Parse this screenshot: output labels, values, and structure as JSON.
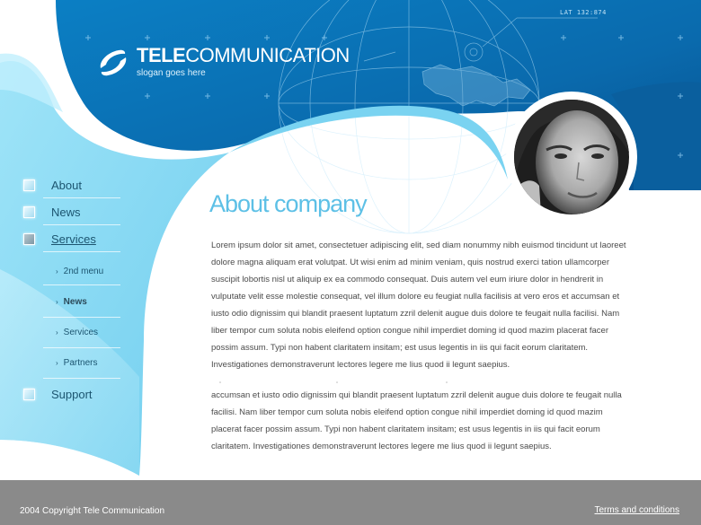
{
  "brand": {
    "name_bold": "TELE",
    "name_rest": "COMMUNICATION",
    "slogan": "slogan goes here",
    "logo_icon": "swirl-logo-icon"
  },
  "header": {
    "coord_label": "LAT 132:874"
  },
  "nav": {
    "items": [
      {
        "label": "About",
        "icon": "square-bullet-icon"
      },
      {
        "label": "News",
        "icon": "square-bullet-icon"
      },
      {
        "label": "Services",
        "icon": "square-bullet-icon",
        "active": true
      },
      {
        "label": "Support",
        "icon": "square-bullet-icon"
      }
    ],
    "subitems": [
      {
        "label": "2nd menu",
        "icon": "arrow-right-icon"
      },
      {
        "label": "News",
        "icon": "arrow-right-icon",
        "current": true
      },
      {
        "label": "Services",
        "icon": "arrow-right-icon"
      },
      {
        "label": "Partners",
        "icon": "arrow-right-icon"
      }
    ]
  },
  "content": {
    "title": "About company",
    "paragraph1": "Lorem ipsum dolor sit amet, consectetuer adipiscing elit, sed diam nonummy nibh euismod tincidunt ut laoreet dolore magna aliquam erat volutpat. Ut wisi enim ad minim veniam, quis nostrud exerci tation ullamcorper suscipit lobortis nisl ut aliquip ex ea commodo consequat. Duis autem vel eum iriure dolor in hendrerit in vulputate velit esse molestie consequat, vel illum dolore eu feugiat nulla facilisis at vero eros et accumsan et iusto odio dignissim qui blandit praesent luptatum zzril delenit augue duis dolore te feugait nulla facilisi. Nam liber tempor cum soluta nobis eleifend option congue nihil imperdiet doming id quod mazim placerat facer possim assum. Typi non habent claritatem insitam; est usus legentis in iis qui facit eorum claritatem. Investigationes demonstraverunt lectores legere me lius quod ii legunt saepius.",
    "paragraph2": "accumsan et iusto odio dignissim qui blandit praesent luptatum zzril delenit augue duis dolore te feugait nulla facilisi. Nam liber tempor cum soluta nobis eleifend option congue nihil imperdiet doming id quod mazim placerat facer possim assum. Typi non habent claritatem insitam; est usus legentis in iis qui facit eorum claritatem. Investigationes demonstraverunt lectores legere me lius quod ii legunt saepius."
  },
  "footer": {
    "copyright": "2004 Copyright Tele Communication",
    "terms": "Terms and conditions"
  },
  "colors": {
    "header_blue": "#0a6fb2",
    "dark_blue": "#075a97",
    "light_cyan": "#8fdcf5",
    "title_cyan": "#5dc0e6",
    "footer_gray": "#8a8a8a"
  }
}
